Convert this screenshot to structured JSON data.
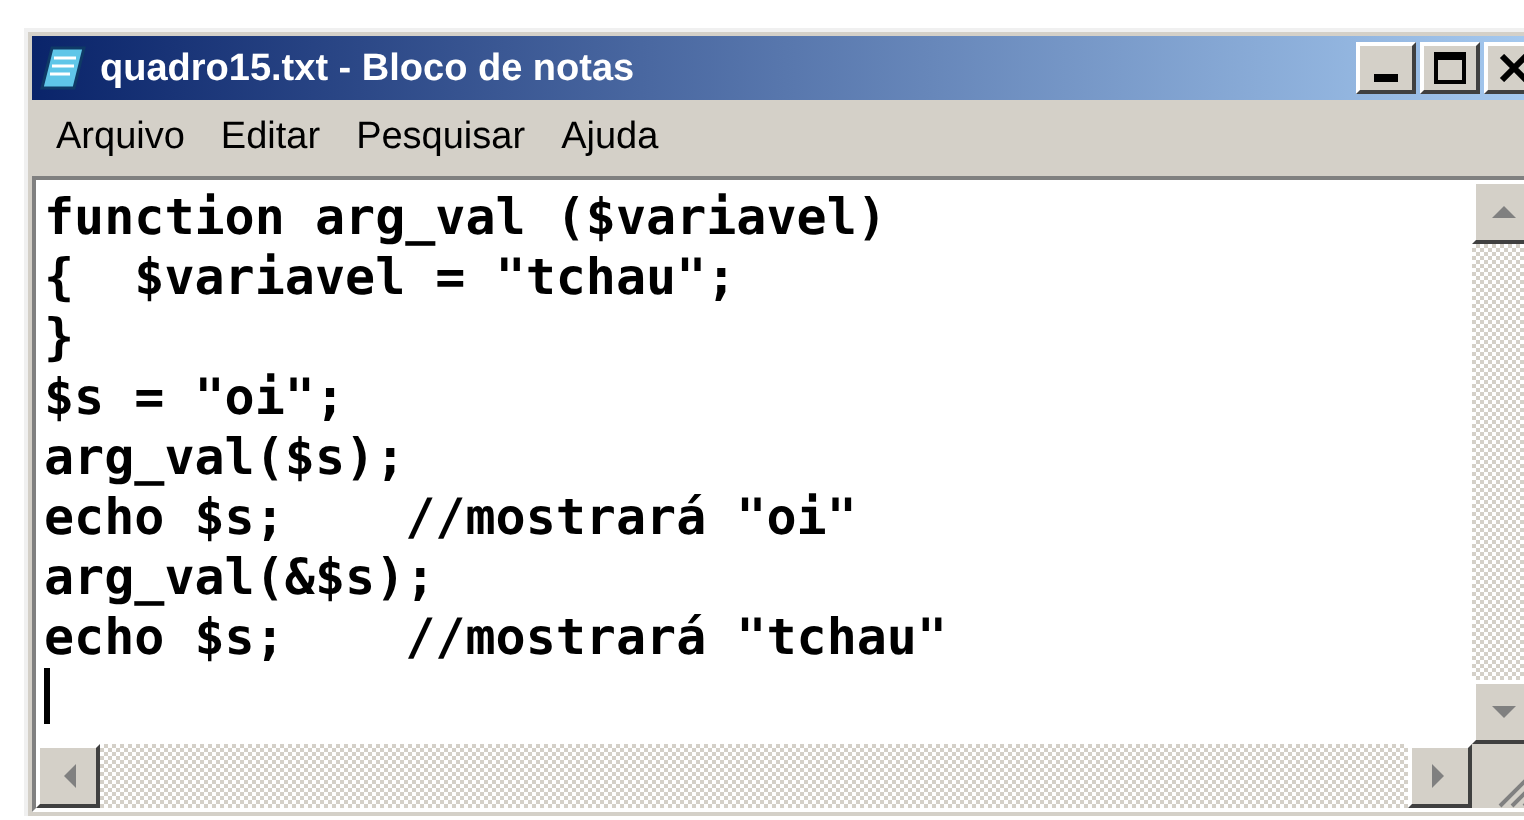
{
  "window": {
    "title": "quadro15.txt - Bloco de notas"
  },
  "menu": [
    {
      "label": "Arquivo"
    },
    {
      "label": "Editar"
    },
    {
      "label": "Pesquisar"
    },
    {
      "label": "Ajuda"
    }
  ],
  "editor": {
    "lines": [
      "function arg_val ($variavel)",
      "{  $variavel = \"tchau\";",
      "}",
      "$s = \"oi\";",
      "arg_val($s);",
      "echo $s;    //mostrará \"oi\"",
      "arg_val(&$s);",
      "echo $s;    //mostrará \"tchau\""
    ]
  }
}
